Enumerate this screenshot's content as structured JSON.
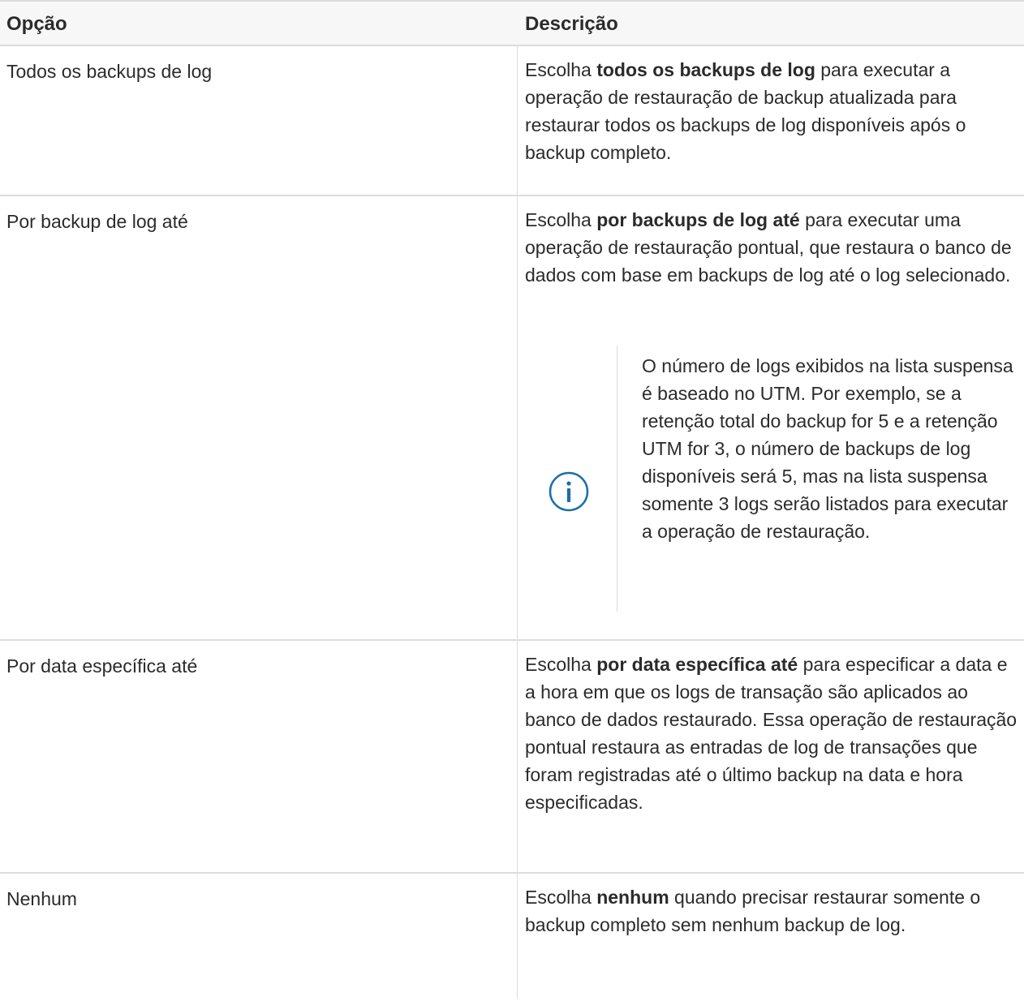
{
  "table": {
    "headers": [
      "Opção",
      "Descrição"
    ],
    "rows": [
      {
        "option": "Todos os backups de log",
        "desc_before": "Escolha ",
        "desc_bold": "todos os backups de log",
        "desc_after": " para executar a operação de restauração de backup atualizada para restaurar todos os backups de log disponíveis após o backup completo."
      },
      {
        "option": "Por backup de log até",
        "desc_before": "Escolha ",
        "desc_bold": "por backups de log até",
        "desc_after": " para executar uma operação de restauração pontual, que restaura o banco de dados com base em backups de log até o log selecionado.",
        "note": "O número de logs exibidos na lista suspensa é baseado no UTM. Por exemplo, se a retenção total do backup for 5 e a retenção UTM for 3, o número de backups de log disponíveis será 5, mas na lista suspensa somente 3 logs serão listados para executar a operação de restauração.",
        "note_icon": "info-circle-icon"
      },
      {
        "option": "Por data específica até",
        "desc_before": "Escolha ",
        "desc_bold": "por data específica até",
        "desc_after": " para especificar a data e a hora em que os logs de transação são aplicados ao banco de dados restaurado. Essa operação de restauração pontual restaura as entradas de log de transações que foram registradas até o último backup na data e hora especificadas."
      },
      {
        "option": "Nenhum",
        "desc_before": "Escolha ",
        "desc_bold": "nenhum",
        "desc_after": " quando precisar restaurar somente o backup completo sem nenhum backup de log."
      }
    ]
  },
  "colors": {
    "info_icon": "#1a6ea8",
    "border": "#dcdcdc",
    "header_bg": "#f7f7f7"
  }
}
